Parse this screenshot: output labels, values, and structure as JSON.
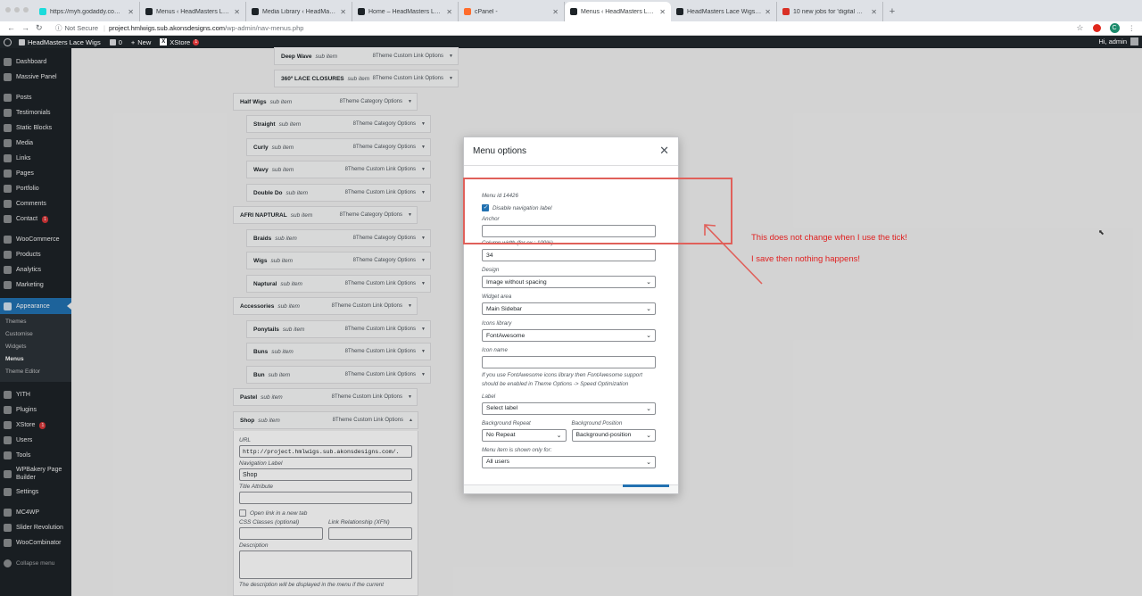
{
  "browser": {
    "tabs": [
      {
        "title": "https://myh.godaddy.com/#/h...",
        "favicon_color": "#1bdbdb",
        "active": false
      },
      {
        "title": "Menus ‹ HeadMasters Lace W...",
        "favicon_color": "#1d2327",
        "active": false
      },
      {
        "title": "Media Library ‹ HeadMasters L...",
        "favicon_color": "#1d2327",
        "active": false
      },
      {
        "title": "Home – HeadMasters Lace Wigs",
        "favicon_color": "#1d2327",
        "active": false
      },
      {
        "title": "cPanel -",
        "favicon_color": "#ff6c2c",
        "active": false
      },
      {
        "title": "Menus ‹ HeadMasters Lace W...",
        "favicon_color": "#1d2327",
        "active": true
      },
      {
        "title": "HeadMasters Lace Wigs – Lac...",
        "favicon_color": "#1d2327",
        "active": false
      },
      {
        "title": "10 new jobs for 'digital marketi...",
        "favicon_color": "#d93025",
        "active": false
      }
    ],
    "new_tab": "+",
    "secure_label": "Not Secure",
    "url_host": "project.hmlwigs.sub.akonsdesigns.com",
    "url_path": "/wp-admin/nav-menus.php"
  },
  "adminbar": {
    "site_name": "HeadMasters Lace Wigs",
    "comments_count": "0",
    "new_label": "New",
    "xstore_label": "XStore",
    "xstore_badge": "1",
    "greeting": "Hi, admin"
  },
  "sidebar": {
    "items": [
      {
        "label": "Dashboard",
        "icon": "dashboard-icon"
      },
      {
        "label": "Massive Panel",
        "icon": "panel-icon"
      },
      {
        "label": "Posts",
        "icon": "pin-icon"
      },
      {
        "label": "Testimonials",
        "icon": "testimonials-icon"
      },
      {
        "label": "Static Blocks",
        "icon": "blocks-icon"
      },
      {
        "label": "Media",
        "icon": "media-icon"
      },
      {
        "label": "Links",
        "icon": "link-icon"
      },
      {
        "label": "Pages",
        "icon": "pages-icon"
      },
      {
        "label": "Portfolio",
        "icon": "portfolio-icon"
      },
      {
        "label": "Comments",
        "icon": "comments-icon"
      },
      {
        "label": "Contact",
        "icon": "mail-icon",
        "badge": "1"
      },
      {
        "label": "WooCommerce",
        "icon": "woo-icon"
      },
      {
        "label": "Products",
        "icon": "products-icon"
      },
      {
        "label": "Analytics",
        "icon": "analytics-icon"
      },
      {
        "label": "Marketing",
        "icon": "megaphone-icon"
      },
      {
        "label": "Appearance",
        "icon": "brush-icon"
      },
      {
        "label": "YITH",
        "icon": "yith-icon"
      },
      {
        "label": "Plugins",
        "icon": "plugin-icon"
      },
      {
        "label": "XStore",
        "icon": "xstore-icon",
        "badge": "1"
      },
      {
        "label": "Users",
        "icon": "users-icon"
      },
      {
        "label": "Tools",
        "icon": "tools-icon"
      },
      {
        "label": "WPBakery Page Builder",
        "icon": "wpbakery-icon"
      },
      {
        "label": "Settings",
        "icon": "settings-icon"
      },
      {
        "label": "MC4WP",
        "icon": "mc4wp-icon"
      },
      {
        "label": "Slider Revolution",
        "icon": "slider-icon"
      },
      {
        "label": "WooCombinator",
        "icon": "combinator-icon"
      }
    ],
    "appearance_sub": [
      "Themes",
      "Customise",
      "Widgets",
      "Menus",
      "Theme Editor"
    ],
    "collapse": "Collapse menu"
  },
  "menu_items": [
    {
      "title": "Deep Wave",
      "sub": "sub item",
      "type": "8Theme Custom Link Options"
    },
    {
      "title": "360º LACE CLOSURES",
      "sub": "sub item",
      "type": "8Theme Custom Link Options"
    },
    {
      "title": "Half Wigs",
      "sub": "sub item",
      "type": "8Theme Category Options"
    },
    {
      "title": "Straight",
      "sub": "sub item",
      "type": "8Theme Category Options"
    },
    {
      "title": "Curly",
      "sub": "sub item",
      "type": "8Theme Category Options"
    },
    {
      "title": "Wavy",
      "sub": "sub item",
      "type": "8Theme Custom Link Options"
    },
    {
      "title": "Double Do",
      "sub": "sub item",
      "type": "8Theme Custom Link Options"
    },
    {
      "title": "AFRI NAPTURAL",
      "sub": "sub item",
      "type": "8Theme Category Options"
    },
    {
      "title": "Braids",
      "sub": "sub item",
      "type": "8Theme Category Options"
    },
    {
      "title": "Wigs",
      "sub": "sub item",
      "type": "8Theme Category Options"
    },
    {
      "title": "Naptural",
      "sub": "sub item",
      "type": "8Theme Custom Link Options"
    },
    {
      "title": "Accessories",
      "sub": "sub item",
      "type": "8Theme Custom Link Options"
    },
    {
      "title": "Ponytails",
      "sub": "sub item",
      "type": "8Theme Custom Link Options"
    },
    {
      "title": "Buns",
      "sub": "sub item",
      "type": "8Theme Custom Link Options"
    },
    {
      "title": "Bun",
      "sub": "sub item",
      "type": "8Theme Custom Link Options"
    },
    {
      "title": "Pastel",
      "sub": "sub item",
      "type": "8Theme Custom Link Options"
    },
    {
      "title": "Shop",
      "sub": "sub item",
      "type": "8Theme Custom Link Options"
    }
  ],
  "shop_panel": {
    "url_label": "URL",
    "url_value": "http://project.hmlwigs.sub.akonsdesigns.com/.",
    "nav_label": "Navigation Label",
    "nav_value": "Shop",
    "title_attr_label": "Title Attribute",
    "new_tab_label": "Open link in a new tab",
    "css_label": "CSS Classes (optional)",
    "xfn_label": "Link Relationship (XFN)",
    "desc_label": "Description",
    "desc_help": "The description will be displayed in the menu if the current"
  },
  "modal": {
    "title": "Menu options",
    "menu_id": "Menu id 14426",
    "disable_label": "Disable navigation label",
    "anchor_label": "Anchor",
    "anchor_value": "",
    "column_width_label": "Column width (for ex.: 100%)",
    "column_width_value": "34",
    "design_label": "Design",
    "design_value": "Image without spacing",
    "widget_area_label": "Widget area",
    "widget_area_value": "Main Sidebar",
    "icons_library_label": "Icons library",
    "icons_library_value": "FontAwesome",
    "icon_name_label": "Icon name",
    "icon_name_value": "",
    "icon_help": "If you use FontAwesome icons library then FontAwesome support should be enabled in Theme Options -> Speed Optimization",
    "label_label": "Label",
    "label_value": "Select label",
    "bg_repeat_label": "Background Repeat",
    "bg_repeat_value": "No Repeat",
    "bg_position_label": "Background Position",
    "bg_position_value": "Background-position",
    "shown_for_label": "Menu item is shown only for:",
    "shown_for_value": "All users"
  },
  "annotations": {
    "note1": "This does not change when I use the tick!",
    "note2": "I save then nothing happens!",
    "color": "#e02020"
  }
}
